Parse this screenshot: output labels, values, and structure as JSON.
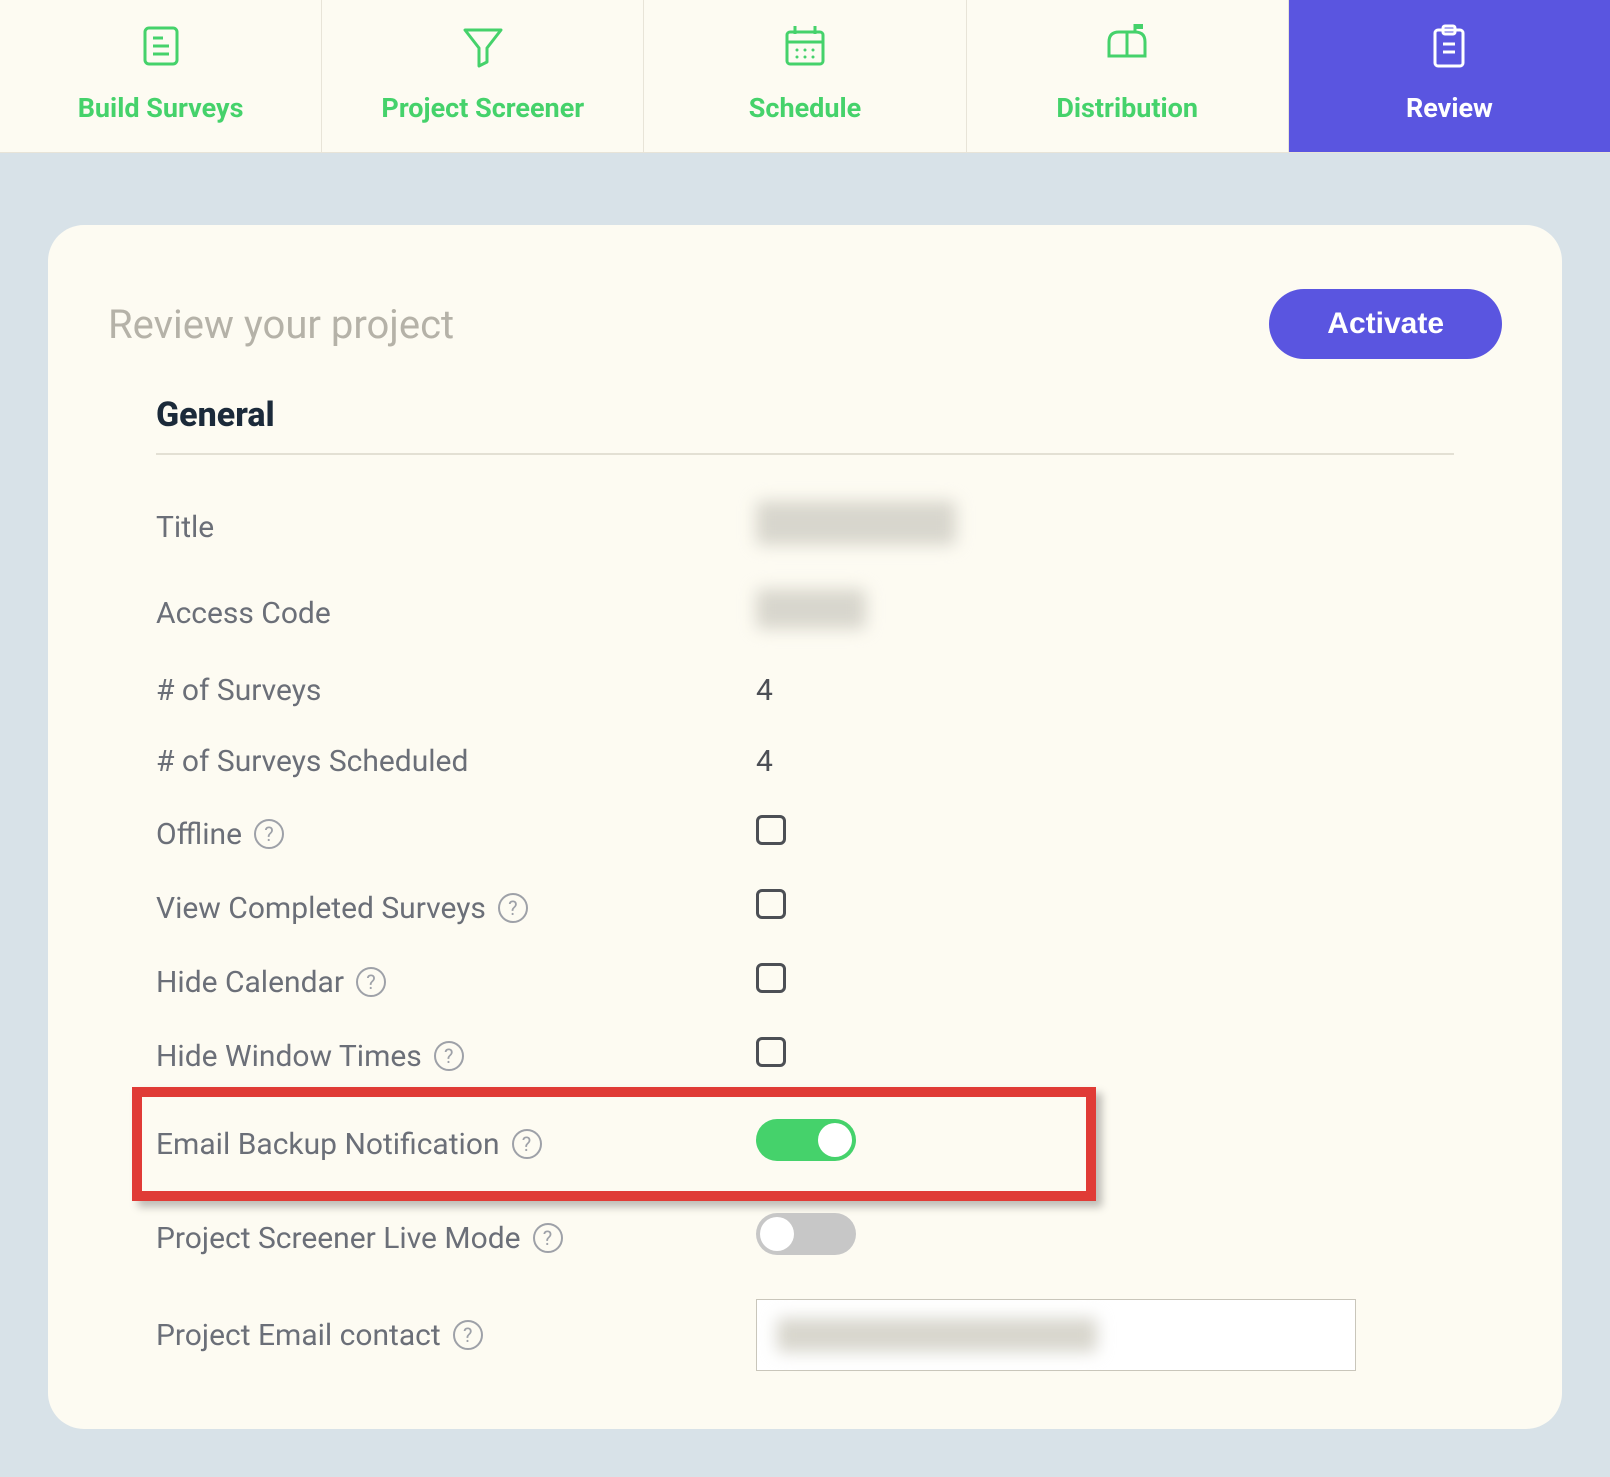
{
  "tabs": [
    {
      "label": "Build Surveys"
    },
    {
      "label": "Project Screener"
    },
    {
      "label": "Schedule"
    },
    {
      "label": "Distribution"
    },
    {
      "label": "Review"
    }
  ],
  "page": {
    "title": "Review your project",
    "activate": "Activate"
  },
  "section": {
    "title": "General",
    "rows": {
      "title_label": "Title",
      "access_code_label": "Access Code",
      "num_surveys_label": "# of Surveys",
      "num_surveys_value": "4",
      "num_scheduled_label": "# of Surveys Scheduled",
      "num_scheduled_value": "4",
      "offline_label": "Offline",
      "view_completed_label": "View Completed Surveys",
      "hide_calendar_label": "Hide Calendar",
      "hide_window_label": "Hide Window Times",
      "email_backup_label": "Email Backup Notification",
      "screener_live_label": "Project Screener Live Mode",
      "email_contact_label": "Project Email contact"
    },
    "toggles": {
      "email_backup": "on",
      "screener_live": "off"
    }
  },
  "help_glyph": "?"
}
